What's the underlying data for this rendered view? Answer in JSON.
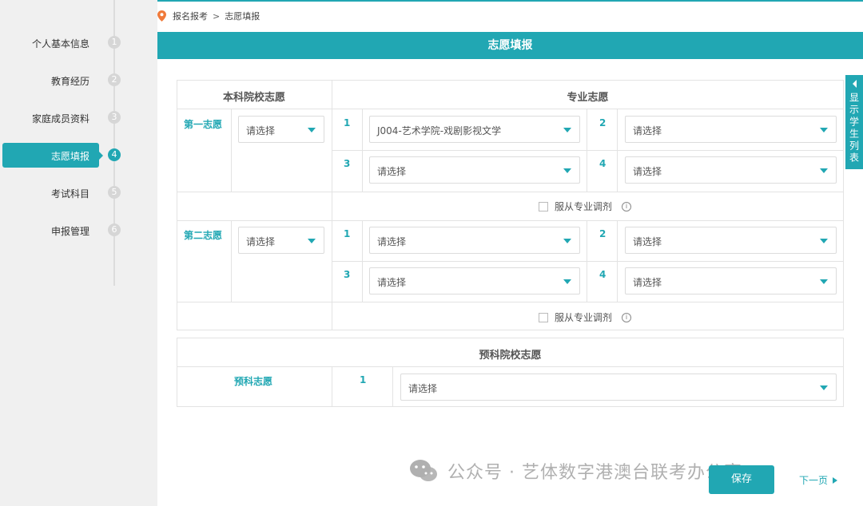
{
  "sidebar": {
    "items": [
      {
        "label": "个人基本信息",
        "num": "1"
      },
      {
        "label": "教育经历",
        "num": "2"
      },
      {
        "label": "家庭成员资料",
        "num": "3"
      },
      {
        "label": "志愿填报",
        "num": "4",
        "active": true
      },
      {
        "label": "考试科目",
        "num": "5"
      },
      {
        "label": "申报管理",
        "num": "6"
      }
    ]
  },
  "breadcrumb": {
    "parent": "报名报考",
    "sep": ">",
    "current": "志愿填报"
  },
  "header": {
    "title": "志愿填报"
  },
  "drawer": {
    "label": "显示学生列表"
  },
  "undergrad": {
    "college_header": "本科院校志愿",
    "major_header": "专业志愿",
    "choices": [
      {
        "label": "第一志愿",
        "college": "请选择",
        "majors": [
          {
            "idx": "1",
            "value": "J004-艺术学院-戏剧影视文学"
          },
          {
            "idx": "2",
            "value": "请选择"
          },
          {
            "idx": "3",
            "value": "请选择"
          },
          {
            "idx": "4",
            "value": "请选择"
          }
        ],
        "adjust_label": "服从专业调剂"
      },
      {
        "label": "第二志愿",
        "college": "请选择",
        "majors": [
          {
            "idx": "1",
            "value": "请选择"
          },
          {
            "idx": "2",
            "value": "请选择"
          },
          {
            "idx": "3",
            "value": "请选择"
          },
          {
            "idx": "4",
            "value": "请选择"
          }
        ],
        "adjust_label": "服从专业调剂"
      }
    ]
  },
  "prep": {
    "header": "预科院校志愿",
    "label": "预科志愿",
    "idx": "1",
    "value": "请选择"
  },
  "footer": {
    "save": "保存",
    "next": "下一页"
  },
  "watermark": {
    "text": "公众号 · 艺体数字港澳台联考办公室"
  },
  "colors": {
    "accent": "#21a7b3",
    "sidebar_bg": "#f0f0f0"
  }
}
